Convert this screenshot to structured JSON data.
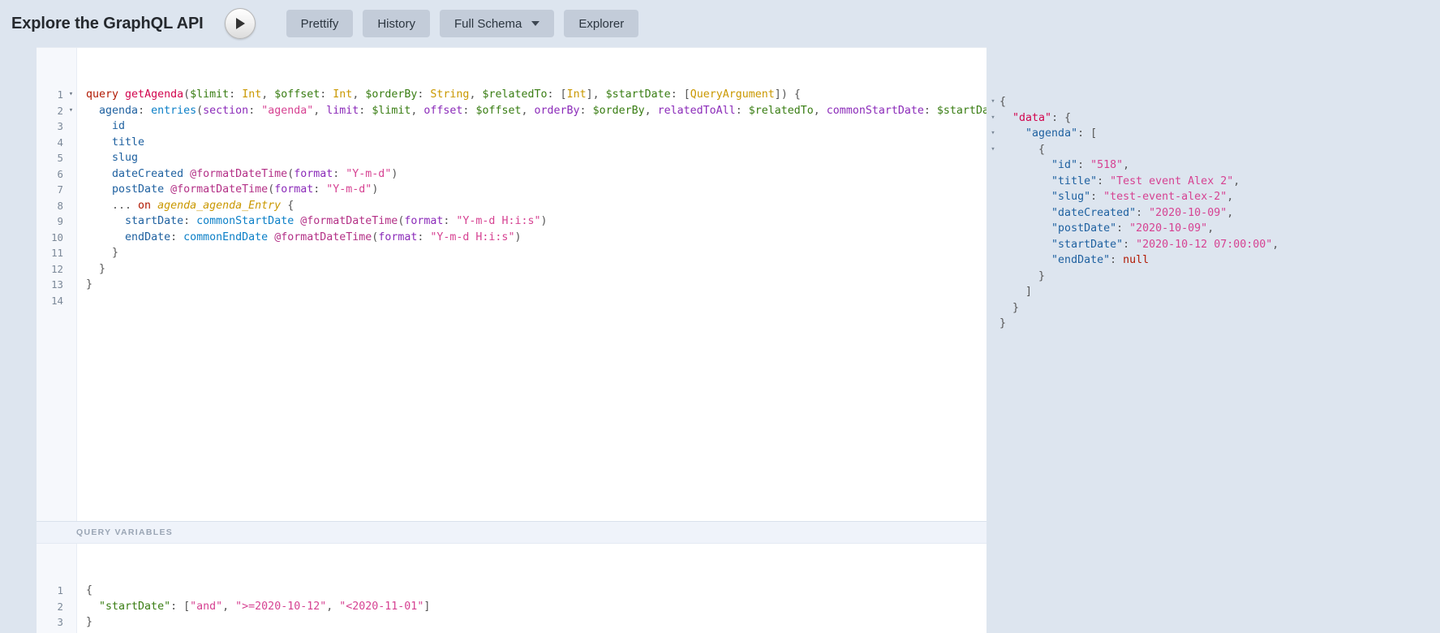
{
  "toolbar": {
    "app_title": "Explore the GraphQL API",
    "execute_icon": "play-icon",
    "prettify_label": "Prettify",
    "history_label": "History",
    "full_schema_label": "Full Schema",
    "full_schema_caret": "chevron-down-icon",
    "explorer_label": "Explorer"
  },
  "query_editor": {
    "line_numbers": [
      "1",
      "2",
      "3",
      "4",
      "5",
      "6",
      "7",
      "8",
      "9",
      "10",
      "11",
      "12",
      "13",
      "14"
    ],
    "fold_markers": [
      "▾",
      "▾",
      "",
      "",
      "",
      "",
      "",
      "",
      "",
      "",
      "",
      "",
      "",
      ""
    ],
    "lines": [
      [
        {
          "t": "query",
          "c": "t-kw"
        },
        {
          "t": " ",
          "c": "t-punct"
        },
        {
          "t": "getAgenda",
          "c": "t-def"
        },
        {
          "t": "(",
          "c": "t-punct"
        },
        {
          "t": "$limit",
          "c": "t-var"
        },
        {
          "t": ": ",
          "c": "t-punct"
        },
        {
          "t": "Int",
          "c": "t-type"
        },
        {
          "t": ", ",
          "c": "t-punct"
        },
        {
          "t": "$offset",
          "c": "t-var"
        },
        {
          "t": ": ",
          "c": "t-punct"
        },
        {
          "t": "Int",
          "c": "t-type"
        },
        {
          "t": ", ",
          "c": "t-punct"
        },
        {
          "t": "$orderBy",
          "c": "t-var"
        },
        {
          "t": ": ",
          "c": "t-punct"
        },
        {
          "t": "String",
          "c": "t-type"
        },
        {
          "t": ", ",
          "c": "t-punct"
        },
        {
          "t": "$relatedTo",
          "c": "t-var"
        },
        {
          "t": ": ",
          "c": "t-punct"
        },
        {
          "t": "[",
          "c": "t-punct"
        },
        {
          "t": "Int",
          "c": "t-type"
        },
        {
          "t": "]",
          "c": "t-punct"
        },
        {
          "t": ", ",
          "c": "t-punct"
        },
        {
          "t": "$startDate",
          "c": "t-var"
        },
        {
          "t": ": ",
          "c": "t-punct"
        },
        {
          "t": "[",
          "c": "t-punct"
        },
        {
          "t": "QueryArgument",
          "c": "t-type"
        },
        {
          "t": "]",
          "c": "t-punct"
        },
        {
          "t": ") {",
          "c": "t-punct"
        }
      ],
      [
        {
          "t": "  ",
          "c": "t-punct"
        },
        {
          "t": "agenda",
          "c": "t-alias"
        },
        {
          "t": ": ",
          "c": "t-punct"
        },
        {
          "t": "entries",
          "c": "t-atom"
        },
        {
          "t": "(",
          "c": "t-punct"
        },
        {
          "t": "section",
          "c": "t-attr"
        },
        {
          "t": ": ",
          "c": "t-punct"
        },
        {
          "t": "\"agenda\"",
          "c": "t-string"
        },
        {
          "t": ", ",
          "c": "t-punct"
        },
        {
          "t": "limit",
          "c": "t-attr"
        },
        {
          "t": ": ",
          "c": "t-punct"
        },
        {
          "t": "$limit",
          "c": "t-var"
        },
        {
          "t": ", ",
          "c": "t-punct"
        },
        {
          "t": "offset",
          "c": "t-attr"
        },
        {
          "t": ": ",
          "c": "t-punct"
        },
        {
          "t": "$offset",
          "c": "t-var"
        },
        {
          "t": ", ",
          "c": "t-punct"
        },
        {
          "t": "orderBy",
          "c": "t-attr"
        },
        {
          "t": ": ",
          "c": "t-punct"
        },
        {
          "t": "$orderBy",
          "c": "t-var"
        },
        {
          "t": ", ",
          "c": "t-punct"
        },
        {
          "t": "relatedToAll",
          "c": "t-attr"
        },
        {
          "t": ": ",
          "c": "t-punct"
        },
        {
          "t": "$relatedTo",
          "c": "t-var"
        },
        {
          "t": ", ",
          "c": "t-punct"
        },
        {
          "t": "commonStartDate",
          "c": "t-attr"
        },
        {
          "t": ": ",
          "c": "t-punct"
        },
        {
          "t": "$startDate",
          "c": "t-var"
        },
        {
          "t": ") {",
          "c": "t-punct"
        }
      ],
      [
        {
          "t": "    ",
          "c": "t-punct"
        },
        {
          "t": "id",
          "c": "t-prop"
        }
      ],
      [
        {
          "t": "    ",
          "c": "t-punct"
        },
        {
          "t": "title",
          "c": "t-prop"
        }
      ],
      [
        {
          "t": "    ",
          "c": "t-punct"
        },
        {
          "t": "slug",
          "c": "t-prop"
        }
      ],
      [
        {
          "t": "    ",
          "c": "t-punct"
        },
        {
          "t": "dateCreated",
          "c": "t-prop"
        },
        {
          "t": " ",
          "c": "t-punct"
        },
        {
          "t": "@formatDateTime",
          "c": "t-meta"
        },
        {
          "t": "(",
          "c": "t-punct"
        },
        {
          "t": "format",
          "c": "t-attr"
        },
        {
          "t": ": ",
          "c": "t-punct"
        },
        {
          "t": "\"Y-m-d\"",
          "c": "t-string"
        },
        {
          "t": ")",
          "c": "t-punct"
        }
      ],
      [
        {
          "t": "    ",
          "c": "t-punct"
        },
        {
          "t": "postDate",
          "c": "t-prop"
        },
        {
          "t": " ",
          "c": "t-punct"
        },
        {
          "t": "@formatDateTime",
          "c": "t-meta"
        },
        {
          "t": "(",
          "c": "t-punct"
        },
        {
          "t": "format",
          "c": "t-attr"
        },
        {
          "t": ": ",
          "c": "t-punct"
        },
        {
          "t": "\"Y-m-d\"",
          "c": "t-string"
        },
        {
          "t": ")",
          "c": "t-punct"
        }
      ],
      [
        {
          "t": "    ... ",
          "c": "t-punct"
        },
        {
          "t": "on",
          "c": "t-kw"
        },
        {
          "t": " ",
          "c": "t-punct"
        },
        {
          "t": "agenda_agenda_Entry",
          "c": "t-frag"
        },
        {
          "t": " {",
          "c": "t-punct"
        }
      ],
      [
        {
          "t": "      ",
          "c": "t-punct"
        },
        {
          "t": "startDate",
          "c": "t-alias"
        },
        {
          "t": ": ",
          "c": "t-punct"
        },
        {
          "t": "commonStartDate",
          "c": "t-field2"
        },
        {
          "t": " ",
          "c": "t-punct"
        },
        {
          "t": "@formatDateTime",
          "c": "t-meta"
        },
        {
          "t": "(",
          "c": "t-punct"
        },
        {
          "t": "format",
          "c": "t-attr"
        },
        {
          "t": ": ",
          "c": "t-punct"
        },
        {
          "t": "\"Y-m-d H:i:s\"",
          "c": "t-string"
        },
        {
          "t": ")",
          "c": "t-punct"
        }
      ],
      [
        {
          "t": "      ",
          "c": "t-punct"
        },
        {
          "t": "endDate",
          "c": "t-alias"
        },
        {
          "t": ": ",
          "c": "t-punct"
        },
        {
          "t": "commonEndDate",
          "c": "t-field2"
        },
        {
          "t": " ",
          "c": "t-punct"
        },
        {
          "t": "@formatDateTime",
          "c": "t-meta"
        },
        {
          "t": "(",
          "c": "t-punct"
        },
        {
          "t": "format",
          "c": "t-attr"
        },
        {
          "t": ": ",
          "c": "t-punct"
        },
        {
          "t": "\"Y-m-d H:i:s\"",
          "c": "t-string"
        },
        {
          "t": ")",
          "c": "t-punct"
        }
      ],
      [
        {
          "t": "    }",
          "c": "t-punct"
        }
      ],
      [
        {
          "t": "  }",
          "c": "t-punct"
        }
      ],
      [
        {
          "t": "}",
          "c": "t-punct"
        }
      ],
      [
        {
          "t": "",
          "c": "t-punct"
        }
      ]
    ]
  },
  "variables_pane": {
    "header_label": "QUERY VARIABLES",
    "line_numbers": [
      "1",
      "2",
      "3"
    ],
    "lines": [
      [
        {
          "t": "{",
          "c": "t-punct"
        }
      ],
      [
        {
          "t": "  ",
          "c": "t-punct"
        },
        {
          "t": "\"startDate\"",
          "c": "t-var"
        },
        {
          "t": ": ",
          "c": "t-punct"
        },
        {
          "t": "[",
          "c": "t-punct"
        },
        {
          "t": "\"and\"",
          "c": "t-string"
        },
        {
          "t": ", ",
          "c": "t-punct"
        },
        {
          "t": "\">=2020-10-12\"",
          "c": "t-string"
        },
        {
          "t": ", ",
          "c": "t-punct"
        },
        {
          "t": "\"<2020-11-01\"",
          "c": "t-string"
        },
        {
          "t": "]",
          "c": "t-punct"
        }
      ],
      [
        {
          "t": "}",
          "c": "t-punct"
        }
      ]
    ]
  },
  "result_pane": {
    "fold_markers": [
      "▾",
      "▾",
      "▾",
      "▾",
      "",
      "",
      "",
      "",
      "",
      "",
      "",
      "",
      "",
      "",
      ""
    ],
    "lines": [
      [
        {
          "t": "{",
          "c": "j-punct"
        }
      ],
      [
        {
          "t": "  ",
          "c": "j-punct"
        },
        {
          "t": "\"data\"",
          "c": "j-key-d"
        },
        {
          "t": ": {",
          "c": "j-punct"
        }
      ],
      [
        {
          "t": "    ",
          "c": "j-punct"
        },
        {
          "t": "\"agenda\"",
          "c": "j-key"
        },
        {
          "t": ": [",
          "c": "j-punct"
        }
      ],
      [
        {
          "t": "      {",
          "c": "j-punct"
        }
      ],
      [
        {
          "t": "        ",
          "c": "j-punct"
        },
        {
          "t": "\"id\"",
          "c": "j-key"
        },
        {
          "t": ": ",
          "c": "j-punct"
        },
        {
          "t": "\"518\"",
          "c": "j-str"
        },
        {
          "t": ",",
          "c": "j-punct"
        }
      ],
      [
        {
          "t": "        ",
          "c": "j-punct"
        },
        {
          "t": "\"title\"",
          "c": "j-key"
        },
        {
          "t": ": ",
          "c": "j-punct"
        },
        {
          "t": "\"Test event Alex 2\"",
          "c": "j-str"
        },
        {
          "t": ",",
          "c": "j-punct"
        }
      ],
      [
        {
          "t": "        ",
          "c": "j-punct"
        },
        {
          "t": "\"slug\"",
          "c": "j-key"
        },
        {
          "t": ": ",
          "c": "j-punct"
        },
        {
          "t": "\"test-event-alex-2\"",
          "c": "j-str"
        },
        {
          "t": ",",
          "c": "j-punct"
        }
      ],
      [
        {
          "t": "        ",
          "c": "j-punct"
        },
        {
          "t": "\"dateCreated\"",
          "c": "j-key"
        },
        {
          "t": ": ",
          "c": "j-punct"
        },
        {
          "t": "\"2020-10-09\"",
          "c": "j-str"
        },
        {
          "t": ",",
          "c": "j-punct"
        }
      ],
      [
        {
          "t": "        ",
          "c": "j-punct"
        },
        {
          "t": "\"postDate\"",
          "c": "j-key"
        },
        {
          "t": ": ",
          "c": "j-punct"
        },
        {
          "t": "\"2020-10-09\"",
          "c": "j-str"
        },
        {
          "t": ",",
          "c": "j-punct"
        }
      ],
      [
        {
          "t": "        ",
          "c": "j-punct"
        },
        {
          "t": "\"startDate\"",
          "c": "j-key"
        },
        {
          "t": ": ",
          "c": "j-punct"
        },
        {
          "t": "\"2020-10-12 07:00:00\"",
          "c": "j-str"
        },
        {
          "t": ",",
          "c": "j-punct"
        }
      ],
      [
        {
          "t": "        ",
          "c": "j-punct"
        },
        {
          "t": "\"endDate\"",
          "c": "j-key"
        },
        {
          "t": ": ",
          "c": "j-punct"
        },
        {
          "t": "null",
          "c": "j-null"
        }
      ],
      [
        {
          "t": "      }",
          "c": "j-punct"
        }
      ],
      [
        {
          "t": "    ]",
          "c": "j-punct"
        }
      ],
      [
        {
          "t": "  }",
          "c": "j-punct"
        }
      ],
      [
        {
          "t": "}",
          "c": "j-punct"
        }
      ]
    ]
  }
}
